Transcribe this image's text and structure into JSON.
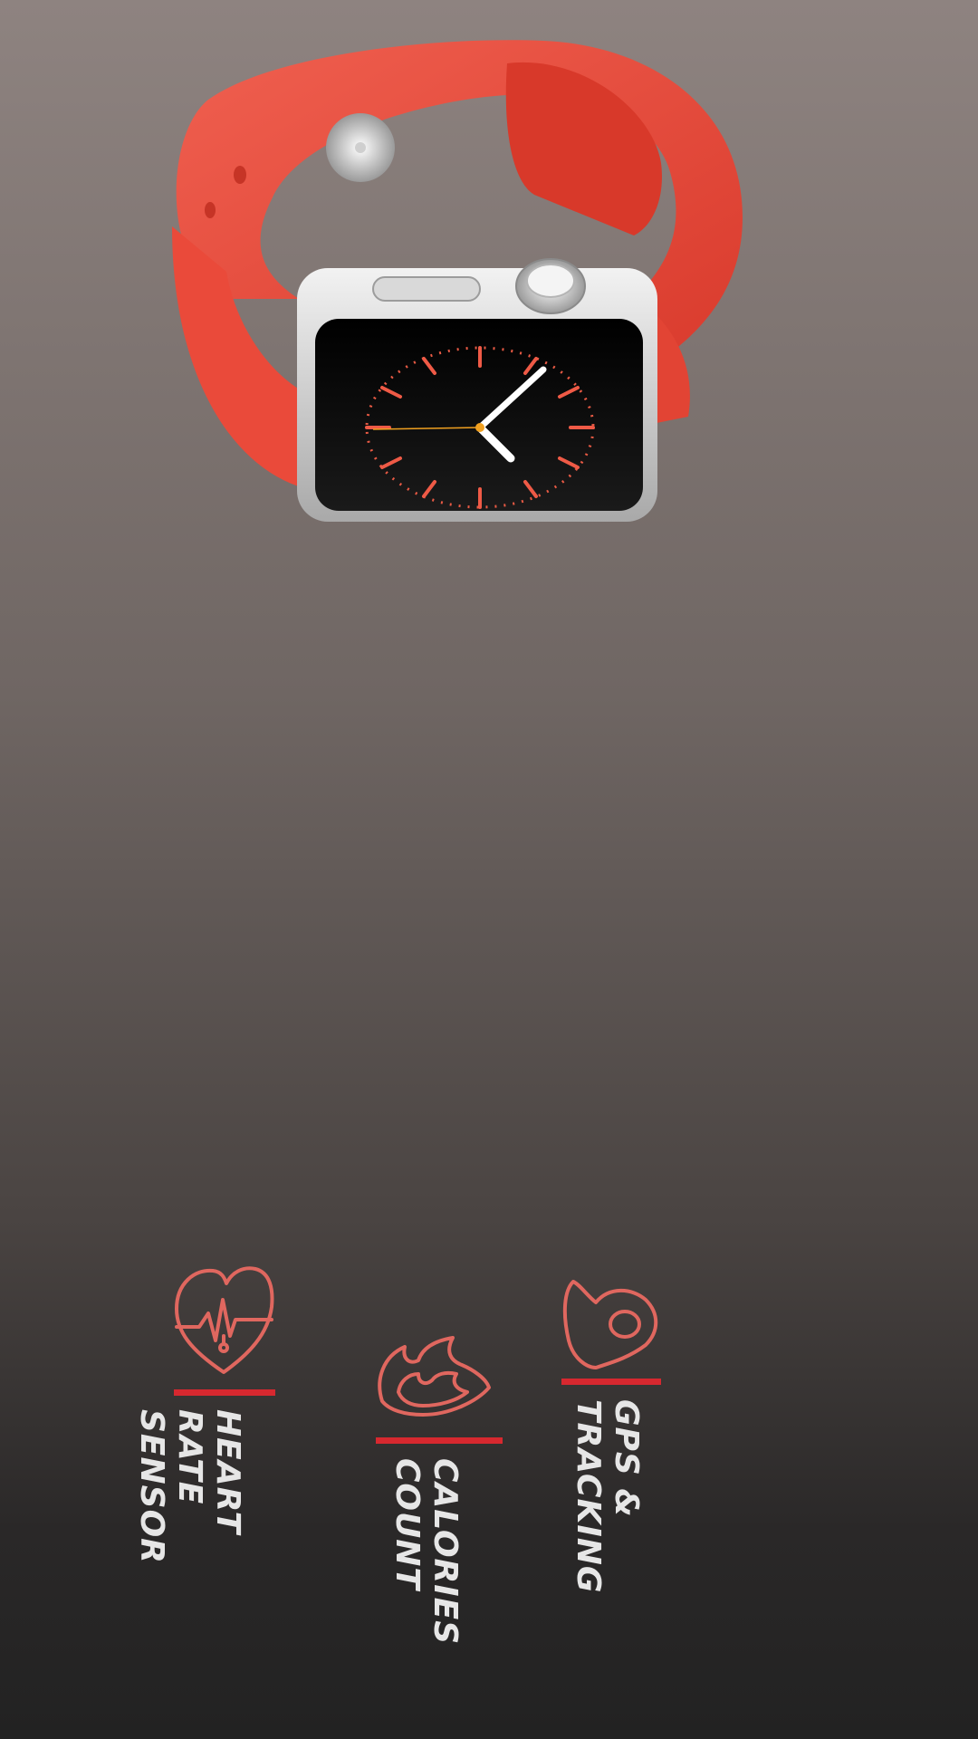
{
  "features": [
    {
      "id": "heart",
      "icon": "heart-pulse-icon",
      "label": "HEART RATE\nSENSOR"
    },
    {
      "id": "calories",
      "icon": "flame-icon",
      "label": "CALORIES\nCOUNT"
    },
    {
      "id": "gps",
      "icon": "location-pin-icon",
      "label": "GPS &\nTRACKING"
    }
  ],
  "colors": {
    "accent": "#d7282f",
    "icon_stroke": "#e0675f",
    "band": "#ee4b3b",
    "text": "#e6e6e6"
  }
}
